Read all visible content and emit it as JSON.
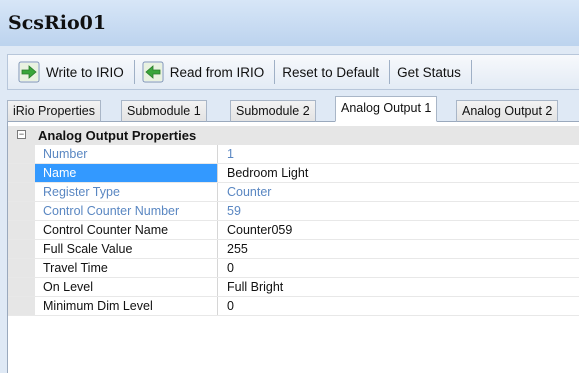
{
  "window": {
    "title": "ScsRio01"
  },
  "toolbar": {
    "write_label": "Write to IRIO",
    "read_label": "Read from IRIO",
    "reset_label": "Reset to Default",
    "status_label": "Get Status"
  },
  "tabs": [
    {
      "label": "iRio Properties"
    },
    {
      "label": "Submodule 1"
    },
    {
      "label": "Submodule 2"
    },
    {
      "label": "Analog Output 1"
    },
    {
      "label": "Analog Output 2"
    }
  ],
  "grid": {
    "category": "Analog Output Properties",
    "collapse_symbol": "−",
    "rows": [
      {
        "name": "Number",
        "value": "1"
      },
      {
        "name": "Name",
        "value": "Bedroom Light"
      },
      {
        "name": "Register Type",
        "value": "Counter"
      },
      {
        "name": "Control Counter Number",
        "value": "59"
      },
      {
        "name": "Control Counter Name",
        "value": "Counter059"
      },
      {
        "name": "Full Scale Value",
        "value": "255"
      },
      {
        "name": "Travel Time",
        "value": "0"
      },
      {
        "name": "On Level",
        "value": "Full Bright"
      },
      {
        "name": "Minimum Dim Level",
        "value": "0"
      }
    ]
  },
  "colors": {
    "selection": "#3399ff",
    "readonly_text": "#5a87c2",
    "icon_green": "#3aa63a"
  }
}
